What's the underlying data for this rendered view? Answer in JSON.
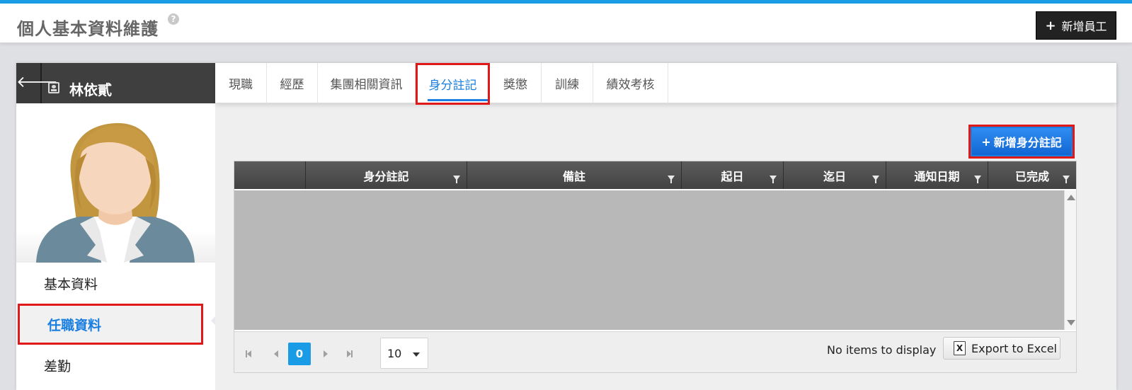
{
  "header": {
    "title": "個人基本資料維護",
    "help_glyph": "?",
    "add_employee_plus": "+",
    "add_employee_label": "新增員工"
  },
  "profile": {
    "back_glyph": "🡐",
    "name": "林依貳"
  },
  "menu": {
    "items": [
      {
        "label": "基本資料"
      },
      {
        "label": "任職資料"
      },
      {
        "label": "差勤"
      }
    ]
  },
  "tabs": [
    {
      "label": "現職"
    },
    {
      "label": "經歷"
    },
    {
      "label": "集團相關資訊"
    },
    {
      "label": "身分註記"
    },
    {
      "label": "獎懲"
    },
    {
      "label": "訓練"
    },
    {
      "label": "績效考核"
    }
  ],
  "actions": {
    "add_note_plus": "+",
    "add_note_label": "新增身分註記"
  },
  "grid": {
    "columns": [
      {
        "label": ""
      },
      {
        "label": "身分註記"
      },
      {
        "label": "備註"
      },
      {
        "label": "起日"
      },
      {
        "label": "迄日"
      },
      {
        "label": "通知日期"
      },
      {
        "label": "已完成"
      }
    ],
    "pager": {
      "current_page": "0",
      "page_size": "10",
      "status": "No items to display",
      "export_label": "Export to Excel",
      "excel_glyph": "X"
    }
  },
  "colors": {
    "accent": "#1a9be6",
    "active_text": "#1a7fe0",
    "highlight": "#e01818"
  }
}
